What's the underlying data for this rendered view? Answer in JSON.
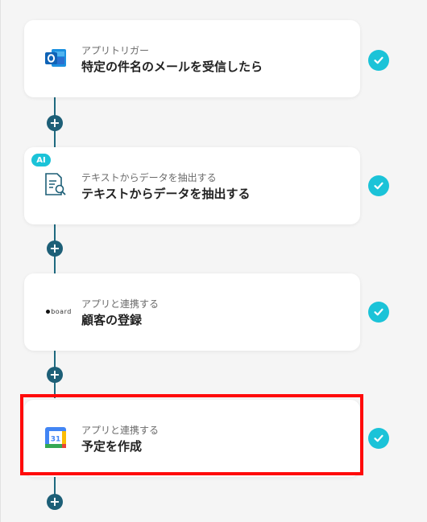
{
  "steps": [
    {
      "subtitle": "アプリトリガー",
      "title": "特定の件名のメールを受信したら",
      "icon": "outlook-icon"
    },
    {
      "subtitle": "テキストからデータを抽出する",
      "title": "テキストからデータを抽出する",
      "icon": "text-extract-icon",
      "badge": "AI"
    },
    {
      "subtitle": "アプリと連携する",
      "title": "顧客の登録",
      "icon": "board-logo-icon",
      "logo_text": "board"
    },
    {
      "subtitle": "アプリと連携する",
      "title": "予定を作成",
      "icon": "google-calendar-icon",
      "calendar_day": "31"
    }
  ],
  "add_label": "+",
  "colors": {
    "check": "#1bc3d8",
    "connector": "#1d5f77",
    "highlight": "#ff0a0a"
  }
}
